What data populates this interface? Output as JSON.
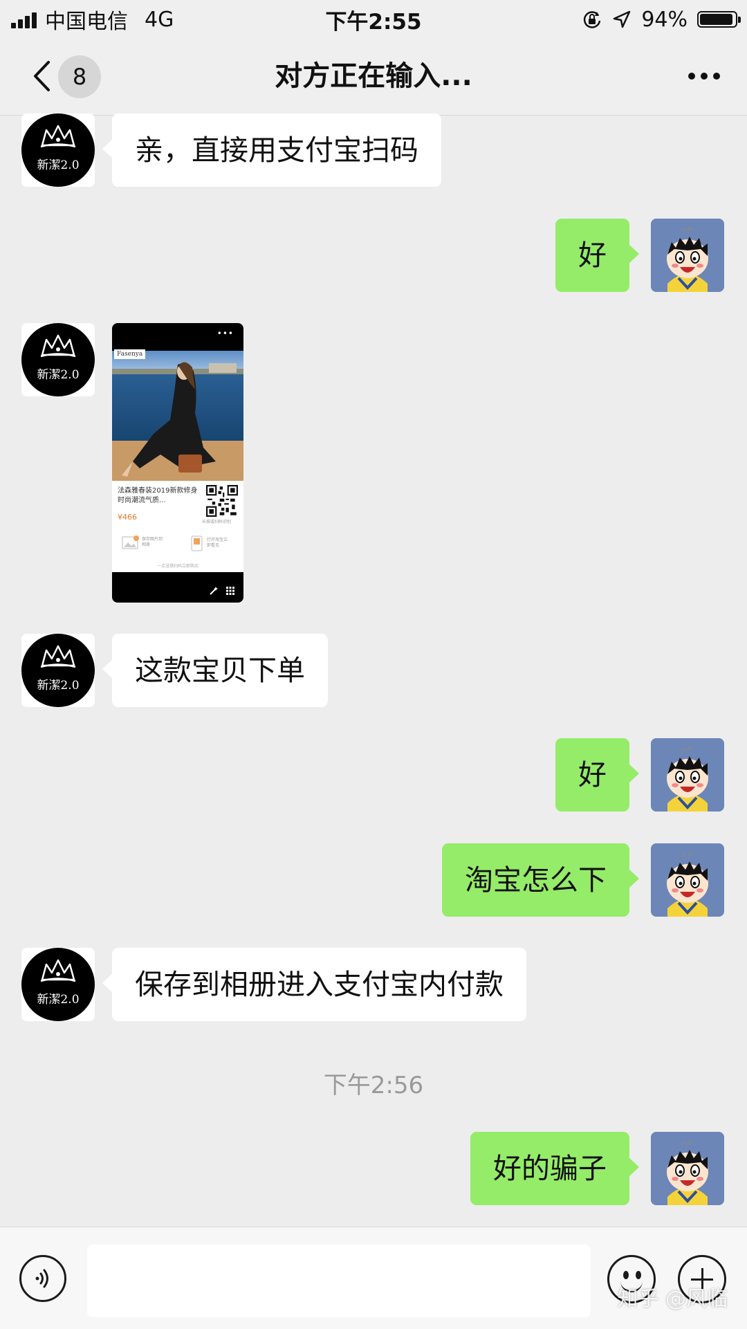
{
  "status_bar": {
    "carrier": "中国电信",
    "network": "4G",
    "time": "下午2:55",
    "battery": "94%",
    "battery_level": 0.94,
    "icons": [
      "signal-icon",
      "orientation-lock-icon",
      "location-icon",
      "battery-icon"
    ]
  },
  "nav": {
    "back_icon": "chevron-left-icon",
    "unread_count": "8",
    "title": "对方正在输入...",
    "more_icon": "more-icon"
  },
  "contact_avatar": {
    "text": "新潔2.0"
  },
  "messages": [
    {
      "sender": "contact",
      "type": "text",
      "text": "亲，直接用支付宝扫码"
    },
    {
      "sender": "me",
      "type": "text",
      "text": "好"
    },
    {
      "sender": "contact",
      "type": "image",
      "card": {
        "brand": "Fasenya",
        "title": "法森雅春装2019新款修身时尚潮流气质...",
        "price": "¥466",
        "qr_tip": "长按或扫码识别",
        "action1": "保存图片到相册",
        "action2": "打开淘宝立即看见",
        "footer": "一点没错扫码立即购买"
      }
    },
    {
      "sender": "contact",
      "type": "text",
      "text": "这款宝贝下单"
    },
    {
      "sender": "me",
      "type": "text",
      "text": "好"
    },
    {
      "sender": "me",
      "type": "text",
      "text": "淘宝怎么下"
    },
    {
      "sender": "contact",
      "type": "text",
      "text": "保存到相册进入支付宝内付款"
    },
    {
      "sender": "system",
      "type": "timestamp",
      "text": "下午2:56"
    },
    {
      "sender": "me",
      "type": "text",
      "text": "好的骗子"
    }
  ],
  "input_bar": {
    "voice_icon": "voice-icon",
    "input_value": "",
    "emoji_icon": "emoji-icon",
    "plus_icon": "plus-icon"
  },
  "watermark": "知乎 @风临",
  "colors": {
    "background": "#ededed",
    "outgoing_bubble": "#95ec69",
    "incoming_bubble": "#ffffff",
    "my_avatar": "#6c86b8"
  }
}
